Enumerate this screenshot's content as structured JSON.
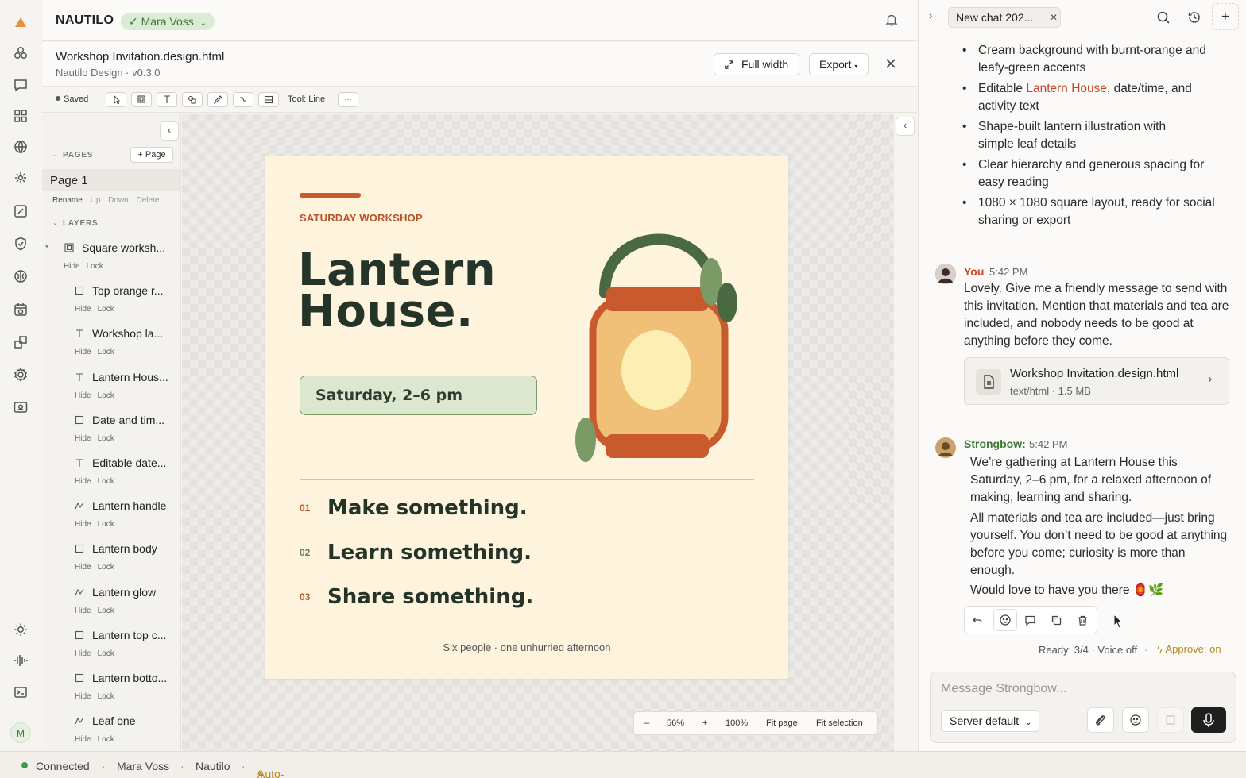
{
  "app": {
    "brand": "NAUTILO",
    "user_chip": "✓ Mara Voss"
  },
  "document": {
    "title": "Workshop Invitation.design.html",
    "subtitle": "Nautilo Design · v0.3.0",
    "full_width_label": "Full width",
    "export_label": "Export"
  },
  "toolbar": {
    "saved_label": "Saved",
    "tool_label": "Tool: Line",
    "more_label": "···"
  },
  "panel": {
    "pages_title": "PAGES",
    "add_page_label": "+ Page",
    "page_name": "Page 1",
    "page_actions": [
      "Rename",
      "Up",
      "Down",
      "Delete"
    ],
    "layers_title": "LAYERS",
    "hide_label": "Hide",
    "lock_label": "Lock",
    "layers": [
      {
        "name": "Square worksh...",
        "icon": "frame-icon"
      },
      {
        "name": "Top orange r...",
        "icon": "rect-icon"
      },
      {
        "name": "Workshop la...",
        "icon": "text-icon"
      },
      {
        "name": "Lantern Hous...",
        "icon": "text-icon"
      },
      {
        "name": "Date and tim...",
        "icon": "rect-icon"
      },
      {
        "name": "Editable date...",
        "icon": "text-icon"
      },
      {
        "name": "Lantern handle",
        "icon": "path-icon"
      },
      {
        "name": "Lantern body",
        "icon": "rect-icon"
      },
      {
        "name": "Lantern glow",
        "icon": "path-icon"
      },
      {
        "name": "Lantern top c...",
        "icon": "rect-icon"
      },
      {
        "name": "Lantern botto...",
        "icon": "rect-icon"
      },
      {
        "name": "Leaf one",
        "icon": "path-icon"
      }
    ]
  },
  "artboard": {
    "kicker": "SATURDAY WORKSHOP",
    "title_line1": "Lantern",
    "title_line2": "House.",
    "date_pill": "Saturday, 2–6 pm",
    "items": [
      {
        "num": "01",
        "text": "Make something."
      },
      {
        "num": "02",
        "text": "Learn something."
      },
      {
        "num": "03",
        "text": "Share something."
      }
    ],
    "footer": "Six people · one unhurried afternoon",
    "colors": {
      "bg": "#fef4de",
      "accent": "#c85a2e",
      "leaf": "#7a9a65",
      "dark": "#2a3a2e",
      "pill": "#dbe7cf"
    }
  },
  "zoom": {
    "minus": "–",
    "level": "56%",
    "plus": "+",
    "hundred": "100%",
    "fit_page": "Fit page",
    "fit_selection": "Fit selection"
  },
  "chat": {
    "tab_label": "New chat 202...",
    "bullets": [
      "Cream background with burnt-orange and leafy-green accents",
      "Shape-built lantern illustration with simple leaf details",
      "Clear hierarchy and generous spacing for easy reading",
      "1080 × 1080 square layout, ready for social sharing or export"
    ],
    "bullet_editable_prefix": "Editable ",
    "bullet_editable_highlight": "Lantern House",
    "bullet_editable_suffix": ", date/time, and activity text",
    "user_message": {
      "name": "You",
      "time": "5:42 PM",
      "text": "Lovely. Give me a friendly message to send with this invitation. Mention that materials and tea are included, and nobody needs to be good at anything before they come."
    },
    "file": {
      "name": "Workshop Invitation.design.html",
      "meta": "text/html · 1.5 MB"
    },
    "bot_message": {
      "name": "Strongbow:",
      "time": "5:42 PM",
      "p1": "We’re gathering at Lantern House this Saturday, 2–6 pm, for a relaxed afternoon of making, learning and sharing.",
      "p2": "All materials and tea are included—just bring yourself. You don’t need to be good at anything before you come; curiosity is more than enough.",
      "p3": "Would love to have you there 🏮🌿"
    },
    "ready_status": "Ready: 3/4 · Voice off",
    "approve_status": "Approve: on",
    "composer_placeholder": "Message Strongbow...",
    "server_select": "Server default"
  },
  "status": {
    "connected": "Connected",
    "user": "Mara Voss",
    "app": "Nautilo",
    "auto_approve": "Auto-Approve"
  }
}
